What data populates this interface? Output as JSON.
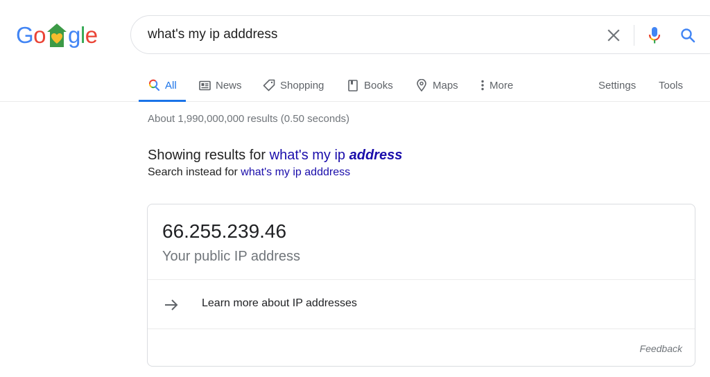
{
  "logo": {
    "letters": [
      "G",
      "o",
      "g",
      "l",
      "e"
    ],
    "colors": {
      "blue": "#4285f4",
      "red": "#ea4335",
      "yellow": "#fbbc05",
      "green": "#34a853",
      "house_green": "#3c9a46",
      "heart_yellow": "#f5bd2d"
    }
  },
  "search": {
    "value": "what's my ip adddress",
    "clear_icon": "close-icon",
    "mic_icon": "microphone-icon",
    "search_icon": "search-icon"
  },
  "tabs": [
    {
      "label": "All",
      "icon": "search-icon",
      "active": true
    },
    {
      "label": "News",
      "icon": "newspaper-icon"
    },
    {
      "label": "Shopping",
      "icon": "tag-icon"
    },
    {
      "label": "Books",
      "icon": "book-icon"
    },
    {
      "label": "Maps",
      "icon": "map-pin-icon"
    },
    {
      "label": "More",
      "icon": "more-vertical-icon"
    },
    {
      "label": "Settings"
    },
    {
      "label": "Tools"
    }
  ],
  "stats": "About 1,990,000,000 results (0.50 seconds)",
  "spelling": {
    "showing_prefix": "Showing results for ",
    "corrected_plain": "what's my ip ",
    "corrected_bold": "address",
    "instead_prefix": "Search instead for ",
    "original_query": "what's my ip adddress"
  },
  "ip_card": {
    "ip": "66.255.239.46",
    "label": "Your public IP address",
    "learn_more": "Learn more about IP addresses",
    "feedback": "Feedback"
  },
  "colors": {
    "accent": "#1a73e8",
    "link": "#1a0dab",
    "muted": "#70757a"
  }
}
